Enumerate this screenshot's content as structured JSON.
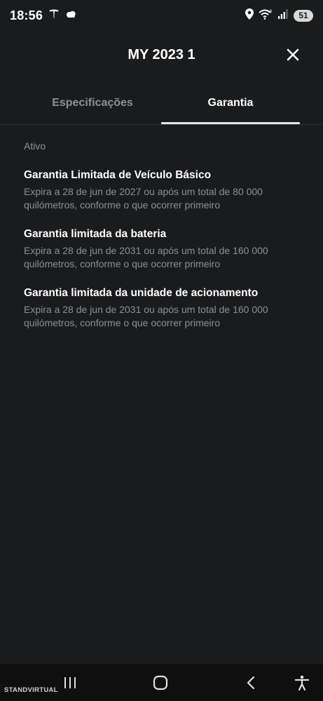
{
  "status_bar": {
    "time": "18:56",
    "battery": "51",
    "icons": [
      "tesla-icon",
      "cloud-icon",
      "location-icon",
      "wifi-icon",
      "signal-icon"
    ]
  },
  "header": {
    "title": "MY 2023 1",
    "close_icon": "close-icon"
  },
  "tabs": [
    {
      "label": "Especificações",
      "active": false
    },
    {
      "label": "Garantia",
      "active": true
    }
  ],
  "section": {
    "label": "Ativo"
  },
  "warranties": [
    {
      "title": "Garantia Limitada de Veículo Básico",
      "description": "Expira a 28 de jun de 2027 ou após um total de 80 000 quilómetros, conforme o que ocorrer primeiro"
    },
    {
      "title": "Garantia limitada da bateria",
      "description": "Expira a 28 de jun de 2031 ou após um total de 160 000 quilómetros, conforme o que ocorrer primeiro"
    },
    {
      "title": "Garantia limitada da unidade de acionamento",
      "description": "Expira a 28 de jun de 2031 ou após um total de 160 000 quilómetros, conforme o que ocorrer primeiro"
    }
  ],
  "nav_bar": {
    "watermark": "STANDVIRTUAL",
    "buttons": [
      "recent-apps-icon",
      "home-icon",
      "back-icon",
      "accessibility-icon"
    ]
  },
  "colors": {
    "background": "#1a1b1d",
    "text_primary": "#ffffff",
    "text_secondary": "#8e8f93",
    "divider": "#33353a"
  }
}
